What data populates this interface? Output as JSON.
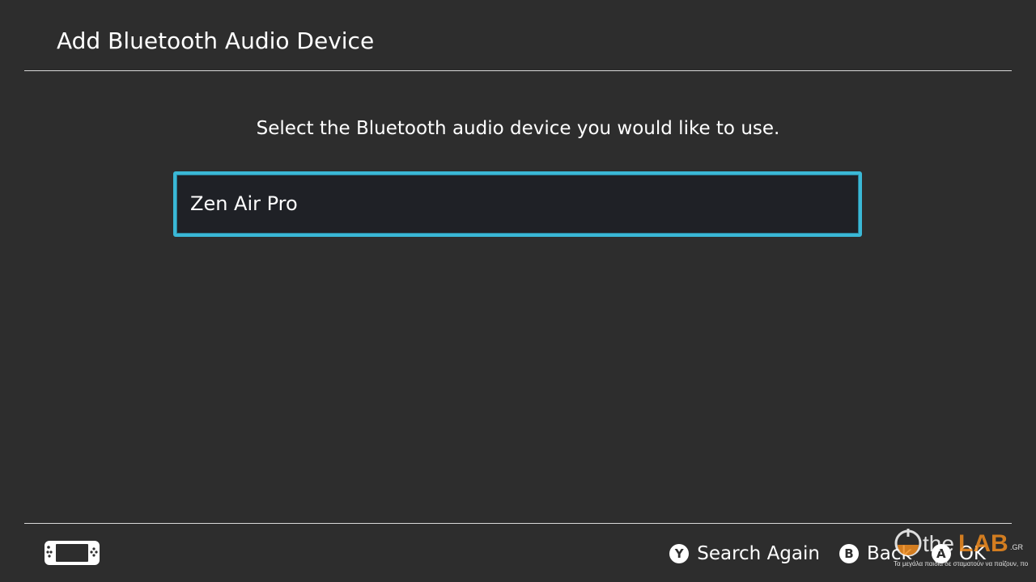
{
  "header": {
    "title": "Add Bluetooth Audio Device"
  },
  "main": {
    "instruction": "Select the Bluetooth audio device you would like to use.",
    "devices": [
      {
        "label": "Zen Air Pro",
        "selected": true
      }
    ]
  },
  "footer": {
    "console_icon": "handheld-console-icon",
    "actions": [
      {
        "button": "Y",
        "label": "Search Again"
      },
      {
        "button": "B",
        "label": "Back"
      },
      {
        "button": "A",
        "label": "OK"
      }
    ]
  },
  "watermark": {
    "brand_the": "the",
    "brand_lab": "LAB",
    "brand_suffix": ".GR",
    "tagline": "Τα μεγάλα παιδιά δε σταματούν να παίζουν, ποτέ"
  },
  "colors": {
    "background": "#2d2d2d",
    "selection_border": "#3ab8d6",
    "item_background": "#1f2126",
    "text": "#ffffff",
    "watermark_accent": "#f08c1e"
  }
}
